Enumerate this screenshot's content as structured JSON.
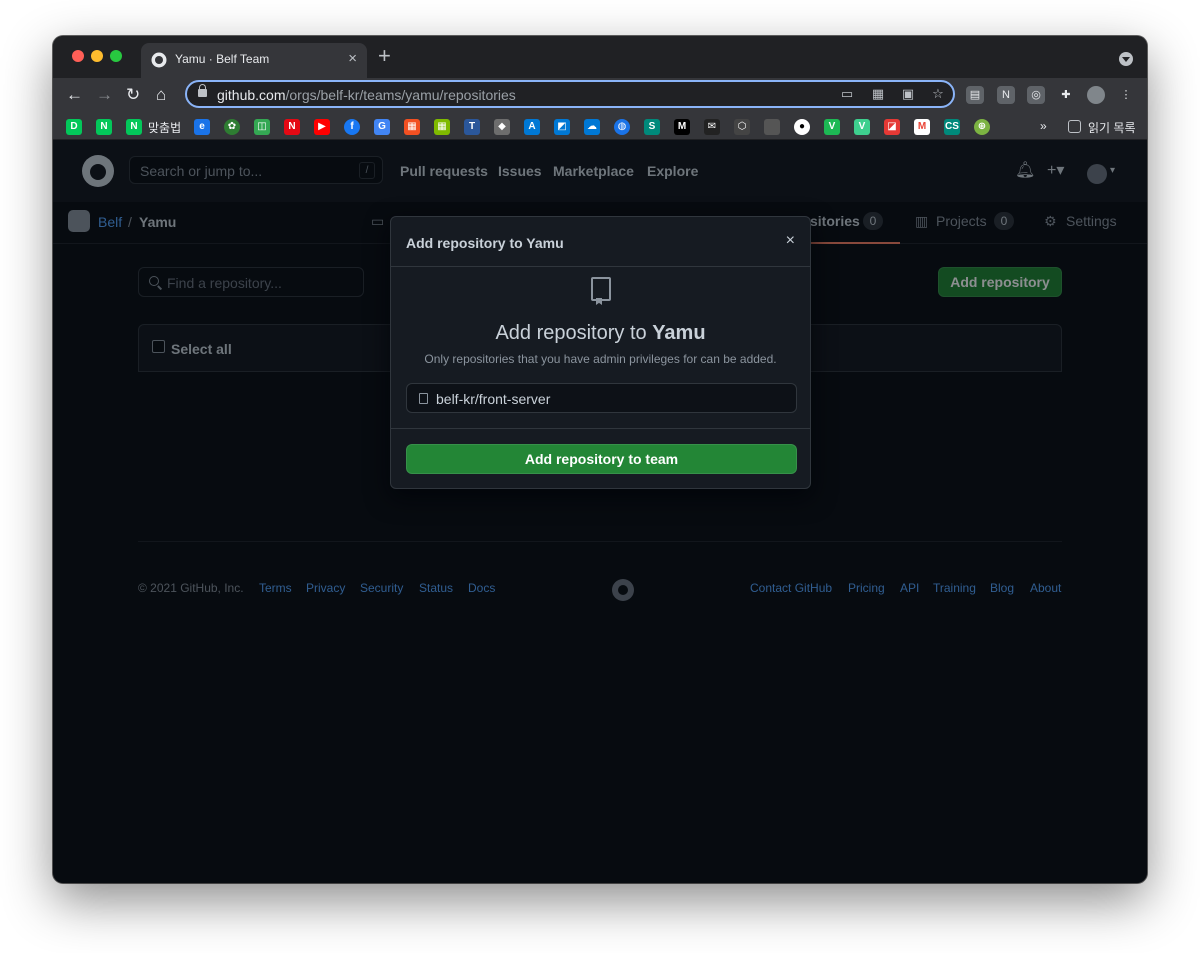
{
  "browser": {
    "tab_title": "Yamu · Belf Team",
    "tab_close": "×",
    "new_tab": "+",
    "url_host": "github.com",
    "url_path": "/orgs/belf-kr/teams/yamu/repositories",
    "bookmark_label": "맞춤법",
    "reading_list": "읽기 목록",
    "more_bookmarks": "»"
  },
  "github_header": {
    "search_placeholder": "Search or jump to...",
    "search_key": "/",
    "nav": [
      "Pull requests",
      "Issues",
      "Marketplace",
      "Explore"
    ]
  },
  "team": {
    "org": "Belf",
    "separator": "/",
    "name": "Yamu",
    "tabs": [
      {
        "label": "Repositories",
        "count": "0"
      },
      {
        "label": "Projects",
        "count": "0"
      },
      {
        "label": "Settings"
      }
    ]
  },
  "main": {
    "find_placeholder": "Find a repository...",
    "add_repository": "Add repository",
    "select_all": "Select all"
  },
  "dialog": {
    "title": "Add repository to Yamu",
    "close": "×",
    "heading_prefix": "Add repository to ",
    "heading_team": "Yamu",
    "subtext": "Only repositories that you have admin privileges for can be added.",
    "repo_value": "belf-kr/front-server",
    "submit": "Add repository to team"
  },
  "footer": {
    "copyright": "© 2021 GitHub, Inc.",
    "left_links": [
      "Terms",
      "Privacy",
      "Security",
      "Status",
      "Docs"
    ],
    "right_links": [
      "Contact GitHub",
      "Pricing",
      "API",
      "Training",
      "Blog",
      "About"
    ]
  },
  "colors": {
    "accent_green": "#238636",
    "link_blue": "#58a6ff",
    "bg": "#0d1117"
  }
}
